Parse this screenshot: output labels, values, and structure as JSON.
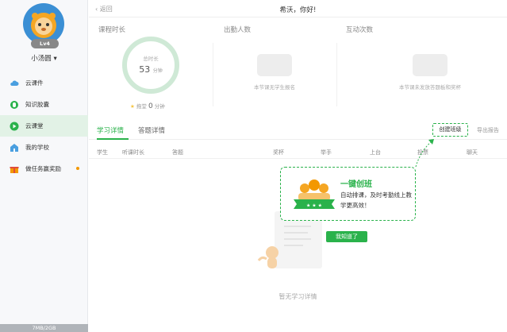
{
  "sidebar": {
    "level": "Lv4",
    "username": "小汤圆",
    "items": [
      {
        "label": "云课件",
        "icon": "cloud-icon"
      },
      {
        "label": "知识胶囊",
        "icon": "capsule-icon"
      },
      {
        "label": "云课堂",
        "icon": "play-icon"
      },
      {
        "label": "我的学校",
        "icon": "school-icon"
      },
      {
        "label": "做任务赢奖励",
        "icon": "gift-icon"
      }
    ],
    "storage": "7MB/2GB"
  },
  "topbar": {
    "back": "返回",
    "greeting": "希沃，你好!"
  },
  "stats": {
    "duration_title": "课程时长",
    "total_label": "总时长",
    "total_value": "53",
    "total_unit": "分钟",
    "drag_label": "拖堂",
    "drag_value": "0",
    "drag_unit": "分钟",
    "attendance_title": "出勤人数",
    "attendance_empty": "本节课无学生报名",
    "interaction_title": "互动次数",
    "interaction_empty": "本节课未发放答题板和奖杯"
  },
  "tabs": {
    "study": "学习详情",
    "answer": "答题详情",
    "create": "创建班级",
    "export": "导出报告"
  },
  "table": {
    "headers": [
      "学生",
      "听课时长",
      "答题",
      "奖杯",
      "举手",
      "上台",
      "投票",
      "聊天"
    ]
  },
  "popup": {
    "title": "一键创班",
    "desc": "自动排课，及时考勤线上教学更高效！",
    "button": "我知道了"
  },
  "empty": {
    "text": "暂无学习详情"
  },
  "colors": {
    "accent": "#2ab24b",
    "active_bg": "#e2f2e6"
  }
}
